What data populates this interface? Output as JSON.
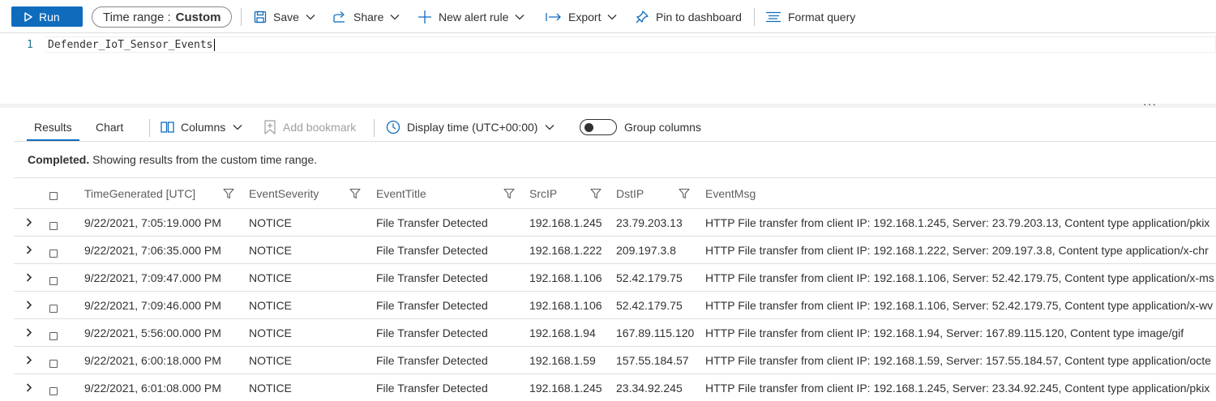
{
  "toolbar": {
    "run": "Run",
    "time_range_label": "Time range :",
    "time_range_value": "Custom",
    "save": "Save",
    "share": "Share",
    "new_alert_rule": "New alert rule",
    "export": "Export",
    "pin_to_dashboard": "Pin to dashboard",
    "format_query": "Format query"
  },
  "editor": {
    "line_number": "1",
    "query": "Defender_IoT_Sensor_Events",
    "more": "···"
  },
  "results_toolbar": {
    "tab_results": "Results",
    "tab_chart": "Chart",
    "columns": "Columns",
    "add_bookmark": "Add bookmark",
    "display_time": "Display time (UTC+00:00)",
    "group_columns": "Group columns"
  },
  "status": {
    "bold": "Completed.",
    "text": " Showing results from the custom time range."
  },
  "grid": {
    "headers": [
      "TimeGenerated [UTC]",
      "EventSeverity",
      "EventTitle",
      "SrcIP",
      "DstIP",
      "EventMsg"
    ],
    "rows": [
      [
        "9/22/2021, 7:05:19.000 PM",
        "NOTICE",
        "File Transfer Detected",
        "192.168.1.245",
        "23.79.203.13",
        "HTTP File transfer from client IP: 192.168.1.245, Server: 23.79.203.13, Content type application/pkix"
      ],
      [
        "9/22/2021, 7:06:35.000 PM",
        "NOTICE",
        "File Transfer Detected",
        "192.168.1.222",
        "209.197.3.8",
        "HTTP File transfer from client IP: 192.168.1.222, Server: 209.197.3.8, Content type application/x-chr"
      ],
      [
        "9/22/2021, 7:09:47.000 PM",
        "NOTICE",
        "File Transfer Detected",
        "192.168.1.106",
        "52.42.179.75",
        "HTTP File transfer from client IP: 192.168.1.106, Server: 52.42.179.75, Content type application/x-ms"
      ],
      [
        "9/22/2021, 7:09:46.000 PM",
        "NOTICE",
        "File Transfer Detected",
        "192.168.1.106",
        "52.42.179.75",
        "HTTP File transfer from client IP: 192.168.1.106, Server: 52.42.179.75, Content type application/x-wv"
      ],
      [
        "9/22/2021, 5:56:00.000 PM",
        "NOTICE",
        "File Transfer Detected",
        "192.168.1.94",
        "167.89.115.120",
        "HTTP File transfer from client IP: 192.168.1.94, Server: 167.89.115.120, Content type image/gif"
      ],
      [
        "9/22/2021, 6:00:18.000 PM",
        "NOTICE",
        "File Transfer Detected",
        "192.168.1.59",
        "157.55.184.57",
        "HTTP File transfer from client IP: 192.168.1.59, Server: 157.55.184.57, Content type application/octe"
      ],
      [
        "9/22/2021, 6:01:08.000 PM",
        "NOTICE",
        "File Transfer Detected",
        "192.168.1.245",
        "23.34.92.245",
        "HTTP File transfer from client IP: 192.168.1.245, Server: 23.34.92.245, Content type application/pkix"
      ]
    ]
  },
  "colors": {
    "accent": "#0f6cbd",
    "text": "#323130",
    "border": "#e1dfdd"
  },
  "icons": [
    "play-icon",
    "save-icon",
    "share-icon",
    "plus-icon",
    "export-arrow-icon",
    "pin-icon",
    "format-lines-icon",
    "columns-icon",
    "bookmark-icon",
    "clock-icon",
    "filter-icon",
    "chevron-right-icon",
    "chevron-down-icon"
  ]
}
